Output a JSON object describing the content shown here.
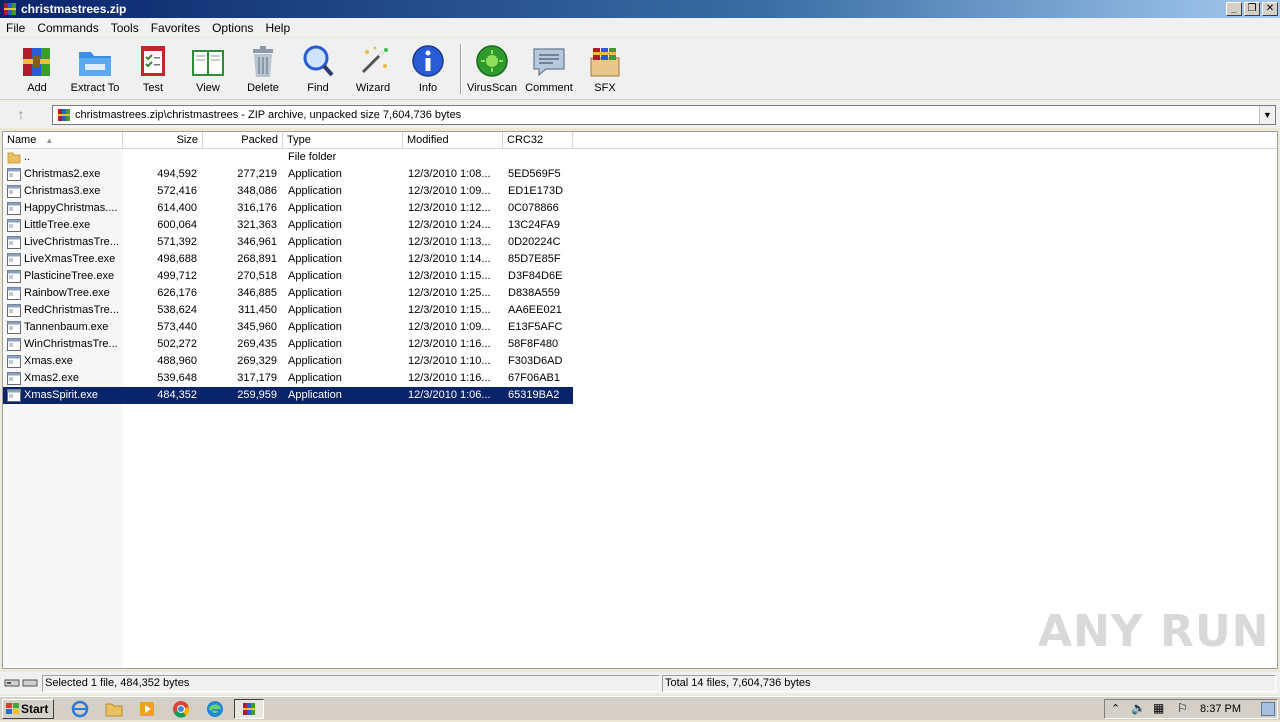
{
  "window": {
    "title": "christmastrees.zip",
    "minimize": "_",
    "restore": "❐",
    "close": "✕"
  },
  "menu": [
    "File",
    "Commands",
    "Tools",
    "Favorites",
    "Options",
    "Help"
  ],
  "toolbar": [
    {
      "label": "Add",
      "icon": "add-archive-icon"
    },
    {
      "label": "Extract To",
      "icon": "extract-folder-icon"
    },
    {
      "label": "Test",
      "icon": "test-clipboard-icon"
    },
    {
      "label": "View",
      "icon": "view-book-icon"
    },
    {
      "label": "Delete",
      "icon": "trash-can-icon"
    },
    {
      "label": "Find",
      "icon": "magnifier-icon"
    },
    {
      "label": "Wizard",
      "icon": "magic-wand-icon"
    },
    {
      "label": "Info",
      "icon": "info-icon"
    },
    {
      "label": "VirusScan",
      "icon": "virus-scan-icon"
    },
    {
      "label": "Comment",
      "icon": "comment-icon"
    },
    {
      "label": "SFX",
      "icon": "sfx-box-icon"
    }
  ],
  "address": {
    "path": "christmastrees.zip\\christmastrees - ZIP archive, unpacked size 7,604,736 bytes",
    "up": "↑"
  },
  "columns": {
    "name": "Name",
    "size": "Size",
    "packed": "Packed",
    "type": "Type",
    "modified": "Modified",
    "crc": "CRC32"
  },
  "parent": {
    "name": "..",
    "type": "File folder"
  },
  "files": [
    {
      "name": "Christmas2.exe",
      "size": "494,592",
      "packed": "277,219",
      "type": "Application",
      "modified": "12/3/2010 1:08...",
      "crc": "5ED569F5"
    },
    {
      "name": "Christmas3.exe",
      "size": "572,416",
      "packed": "348,086",
      "type": "Application",
      "modified": "12/3/2010 1:09...",
      "crc": "ED1E173D"
    },
    {
      "name": "HappyChristmas....",
      "size": "614,400",
      "packed": "316,176",
      "type": "Application",
      "modified": "12/3/2010 1:12...",
      "crc": "0C078866"
    },
    {
      "name": "LittleTree.exe",
      "size": "600,064",
      "packed": "321,363",
      "type": "Application",
      "modified": "12/3/2010 1:24...",
      "crc": "13C24FA9"
    },
    {
      "name": "LiveChristmasTre...",
      "size": "571,392",
      "packed": "346,961",
      "type": "Application",
      "modified": "12/3/2010 1:13...",
      "crc": "0D20224C"
    },
    {
      "name": "LiveXmasTree.exe",
      "size": "498,688",
      "packed": "268,891",
      "type": "Application",
      "modified": "12/3/2010 1:14...",
      "crc": "85D7E85F"
    },
    {
      "name": "PlasticineTree.exe",
      "size": "499,712",
      "packed": "270,518",
      "type": "Application",
      "modified": "12/3/2010 1:15...",
      "crc": "D3F84D6E"
    },
    {
      "name": "RainbowTree.exe",
      "size": "626,176",
      "packed": "346,885",
      "type": "Application",
      "modified": "12/3/2010 1:25...",
      "crc": "D838A559"
    },
    {
      "name": "RedChristmasTre...",
      "size": "538,624",
      "packed": "311,450",
      "type": "Application",
      "modified": "12/3/2010 1:15...",
      "crc": "AA6EE021"
    },
    {
      "name": "Tannenbaum.exe",
      "size": "573,440",
      "packed": "345,960",
      "type": "Application",
      "modified": "12/3/2010 1:09...",
      "crc": "E13F5AFC"
    },
    {
      "name": "WinChristmasTre...",
      "size": "502,272",
      "packed": "269,435",
      "type": "Application",
      "modified": "12/3/2010 1:16...",
      "crc": "58F8F480"
    },
    {
      "name": "Xmas.exe",
      "size": "488,960",
      "packed": "269,329",
      "type": "Application",
      "modified": "12/3/2010 1:10...",
      "crc": "F303D6AD"
    },
    {
      "name": "Xmas2.exe",
      "size": "539,648",
      "packed": "317,179",
      "type": "Application",
      "modified": "12/3/2010 1:16...",
      "crc": "67F06AB1"
    },
    {
      "name": "XmasSpirit.exe",
      "size": "484,352",
      "packed": "259,959",
      "type": "Application",
      "modified": "12/3/2010 1:06...",
      "crc": "65319BA2",
      "selected": true
    }
  ],
  "status": {
    "left": "Selected 1 file, 484,352 bytes",
    "right": "Total 14 files, 7,604,736 bytes"
  },
  "taskbar": {
    "start": "Start",
    "apps": [
      "ie-icon",
      "explorer-folder-icon",
      "media-player-icon",
      "chrome-icon",
      "edge-icon",
      "winrar-icon"
    ],
    "clock": "8:37 PM"
  },
  "watermark": "ANY RUN"
}
